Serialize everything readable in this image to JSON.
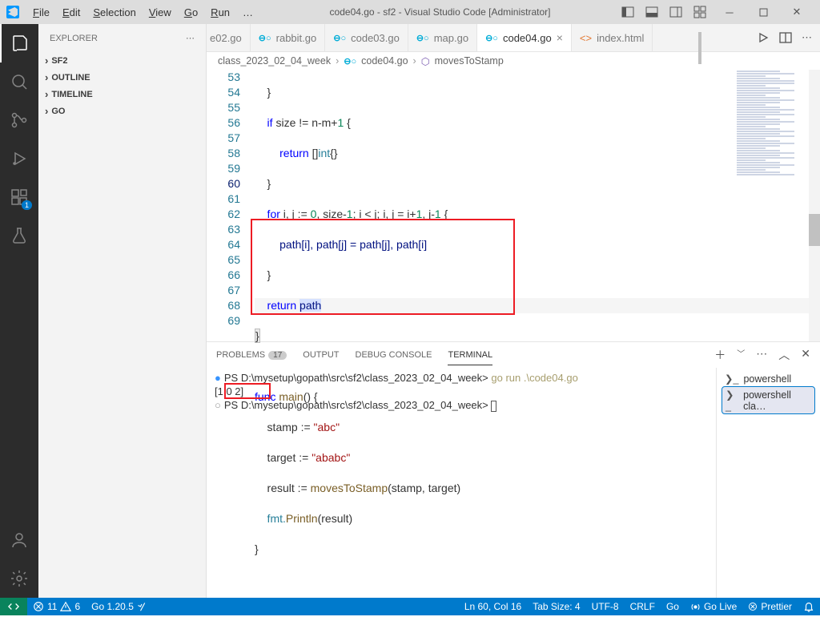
{
  "title": "code04.go - sf2 - Visual Studio Code [Administrator]",
  "menu": [
    "File",
    "Edit",
    "Selection",
    "View",
    "Go",
    "Run",
    "…"
  ],
  "menu_underline": [
    "F",
    "E",
    "S",
    "V",
    "G",
    "R",
    ""
  ],
  "explorer": {
    "label": "EXPLORER",
    "items": [
      {
        "label": "SF2",
        "bold": true
      },
      {
        "label": "OUTLINE",
        "bold": true
      },
      {
        "label": "TIMELINE",
        "bold": true
      },
      {
        "label": "GO",
        "bold": true
      }
    ]
  },
  "tabs": [
    {
      "label": "e02.go",
      "icon": "go",
      "active": false,
      "close": false
    },
    {
      "label": "rabbit.go",
      "icon": "go",
      "active": false,
      "close": false
    },
    {
      "label": "code03.go",
      "icon": "go",
      "active": false,
      "close": false
    },
    {
      "label": "map.go",
      "icon": "go",
      "active": false,
      "close": false
    },
    {
      "label": "code04.go",
      "icon": "go",
      "active": true,
      "close": true
    },
    {
      "label": "index.html",
      "icon": "html",
      "active": false,
      "close": false
    }
  ],
  "breadcrumb": [
    "class_2023_02_04_week",
    "code04.go",
    "movesToStamp"
  ],
  "lines": [
    53,
    54,
    55,
    56,
    57,
    58,
    59,
    60,
    61,
    62,
    63,
    64,
    65,
    66,
    67,
    68,
    69
  ],
  "code": {
    "l53": "    }",
    "l54a": "    if",
    "l54b": " size != n-m+",
    "l54c": "1",
    "l54d": " {",
    "l55a": "        return ",
    "l55b": "[]",
    "l55c": "int",
    "l55d": "{}",
    "l56": "    }",
    "l57a": "    for",
    "l57b": " i, j := ",
    "l57c": "0",
    "l57d": ", size-",
    "l57e": "1",
    "l57f": "; i < j; i, j = i+",
    "l57g": "1",
    "l57h": ", j-",
    "l57i": "1",
    "l57j": " {",
    "l58": "        path[i], path[j] = path[j], path[i]",
    "l59": "    }",
    "l60a": "    return ",
    "l60b": "path",
    "l61": "}",
    "l63a": "func ",
    "l63b": "main",
    "l63c": "() {",
    "l64a": "    stamp := ",
    "l64b": "\"abc\"",
    "l65a": "    target := ",
    "l65b": "\"ababc\"",
    "l66a": "    result := ",
    "l66b": "movesToStamp",
    "l66c": "(stamp, target)",
    "l67a": "    fmt.",
    "l67b": "Println",
    "l67c": "(result)",
    "l68": "}"
  },
  "panel": {
    "tabs": [
      "PROBLEMS",
      "OUTPUT",
      "DEBUG CONSOLE",
      "TERMINAL"
    ],
    "problemsCount": "17",
    "terminal_lines": [
      {
        "dot": "blue",
        "prompt": "PS D:\\mysetup\\gopath\\src\\sf2\\class_2023_02_04_week> ",
        "cmd": "go run .\\code04.go"
      },
      {
        "dot": "",
        "prompt": "[1 0 2]",
        "cmd": ""
      },
      {
        "dot": "grey",
        "prompt": "PS D:\\mysetup\\gopath\\src\\sf2\\class_2023_02_04_week> ",
        "cmd": "",
        "cursor": true
      }
    ],
    "term_sessions": [
      {
        "label": "powershell",
        "active": false
      },
      {
        "label": "powershell  cla…",
        "active": true
      }
    ]
  },
  "status": {
    "errors": "11",
    "warnings": "6",
    "go": "Go 1.20.5",
    "cursor": "Ln 60, Col 16",
    "tab": "Tab Size: 4",
    "enc": "UTF-8",
    "eol": "CRLF",
    "lang": "Go",
    "golive": "Go Live",
    "prettier": "Prettier"
  }
}
